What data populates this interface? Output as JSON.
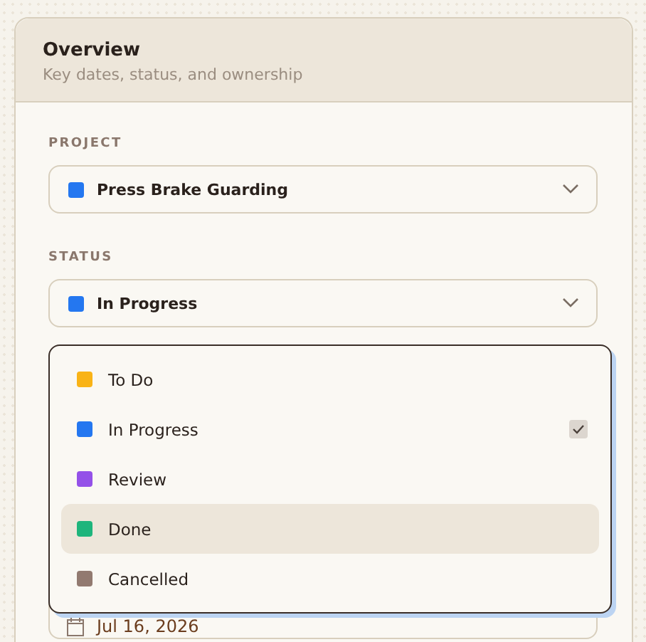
{
  "card": {
    "title": "Overview",
    "subtitle": "Key dates, status, and ownership"
  },
  "fields": [
    {
      "label": "PROJECT",
      "value": "Press Brake Guarding",
      "color": "#2477f0"
    },
    {
      "label": "STATUS",
      "value": "In Progress",
      "color": "#2477f0"
    }
  ],
  "menu": [
    {
      "label": "To Do",
      "color": "#f9b316",
      "selected": false,
      "highlighted": false
    },
    {
      "label": "In Progress",
      "color": "#2477f0",
      "selected": true,
      "highlighted": false
    },
    {
      "label": "Review",
      "color": "#9451e8",
      "selected": false,
      "highlighted": false
    },
    {
      "label": "Done",
      "color": "#1eb57c",
      "selected": false,
      "highlighted": true
    },
    {
      "label": "Cancelled",
      "color": "#927a70",
      "selected": false,
      "highlighted": false
    }
  ],
  "date": {
    "value": "Jul 16, 2026"
  }
}
